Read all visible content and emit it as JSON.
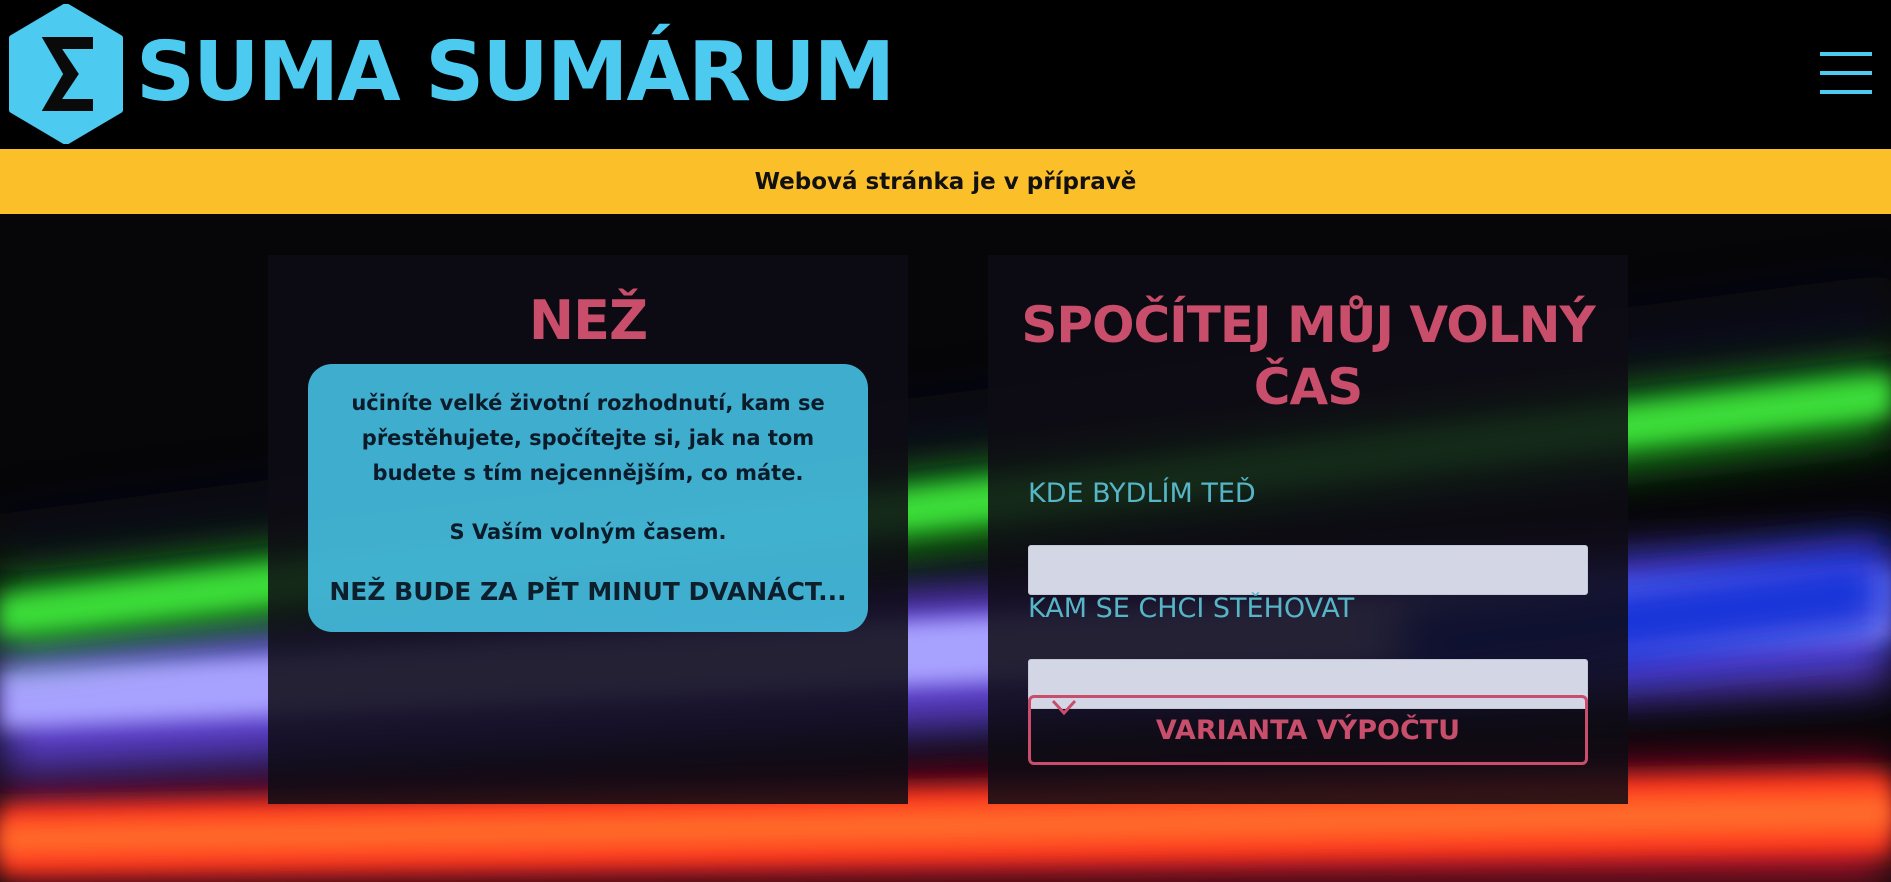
{
  "header": {
    "logo_symbol": "Σ",
    "brand": "SUMA SUMÁRUM",
    "menu_icon": "hamburger-icon"
  },
  "banner": {
    "text": "Webová stránka je v přípravě"
  },
  "left_card": {
    "title": "NEŽ",
    "paragraph1": "učiníte velké životní rozhodnutí, kam se přestěhujete, spočítejte si, jak na tom budete s tím nejcennějším, co máte.",
    "paragraph2": "S Vaším volným časem.",
    "paragraph3": "NEŽ BUDE ZA PĚT MINUT DVANÁCT..."
  },
  "right_card": {
    "title": "SPOČÍTEJ MŮJ VOLNÝ ČAS",
    "current_label": "KDE BYDLÍM TEĎ",
    "current_value": "",
    "target_label": "KAM SE CHCI STĚHOVAT",
    "target_value": "",
    "variant_label": "VARIANTA VÝPOČTU"
  },
  "colors": {
    "accent_blue": "#4ccaf0",
    "banner_yellow": "#fbbf2a",
    "accent_pink": "#c84e6b",
    "label_teal": "#56b6c8"
  }
}
